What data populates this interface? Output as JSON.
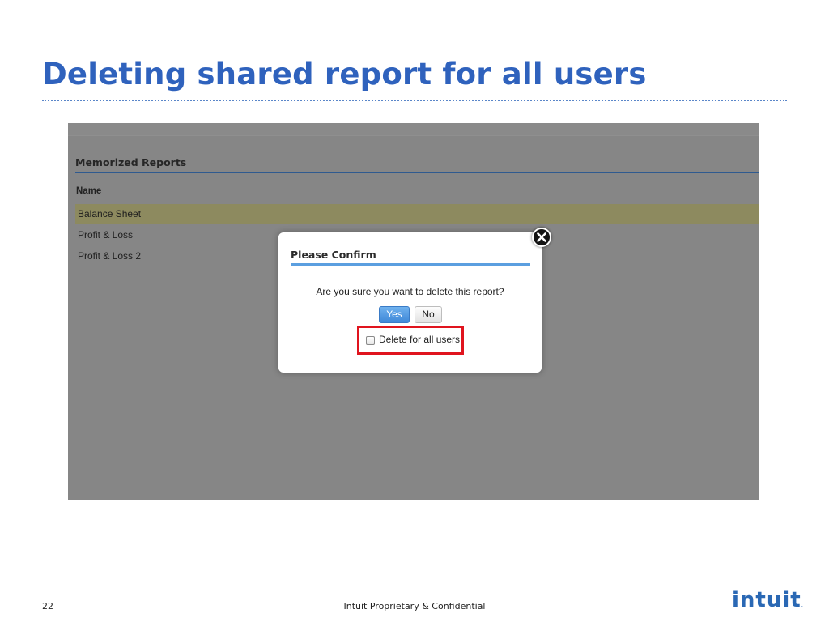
{
  "slide": {
    "title": "Deleting shared report for all users",
    "page_number": "22",
    "footer": "Intuit Proprietary & Confidential",
    "logo": "intuit",
    "logo_mark": ".",
    "title_color": "#2f62bd"
  },
  "memorized_reports": {
    "heading": "Memorized Reports",
    "column_header": "Name",
    "rows": [
      {
        "label": "Balance Sheet",
        "selected": true
      },
      {
        "label": "Profit & Loss",
        "selected": false
      },
      {
        "label": "Profit & Loss 2",
        "selected": false
      }
    ]
  },
  "dialog": {
    "title": "Please Confirm",
    "message": "Are you sure you want to delete this report?",
    "yes_label": "Yes",
    "no_label": "No",
    "checkbox_label": "Delete for all users",
    "checkbox_checked": false,
    "highlight_color": "#e0141e",
    "close_icon": "close-circle-icon"
  }
}
